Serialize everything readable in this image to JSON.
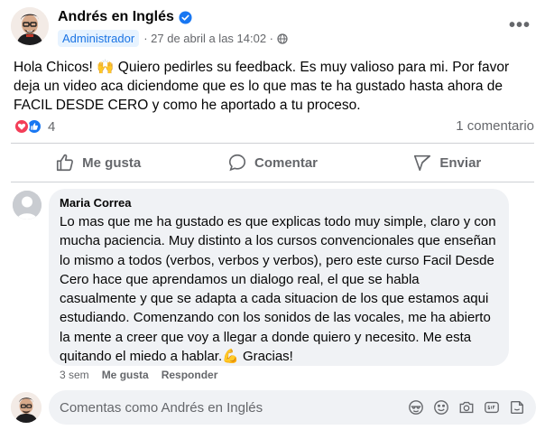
{
  "post": {
    "author": "Andrés en Inglés",
    "role_badge": "Administrador",
    "timestamp": "· 27 de abril a las 14:02 ·",
    "body": "Hola Chicos! 🙌 Quiero pedirles su feedback. Es muy valioso para mi. Por favor deja un video aca diciendome que es lo que mas te ha gustado hasta ahora de FACIL DESDE CERO y como he aportado a tu proceso.",
    "reaction_count": "4",
    "comment_count": "1 comentario",
    "more_label": "•••"
  },
  "actions": {
    "like": "Me gusta",
    "comment": "Comentar",
    "share": "Enviar"
  },
  "comment": {
    "author": "Maria Correa",
    "text": "Lo mas que me ha gustado es que explicas todo muy simple, claro y con mucha paciencia. Muy distinto a los cursos convencionales que enseñan lo mismo a todos (verbos, verbos y verbos), pero este curso Facil Desde Cero hace que aprendamos un dialogo real, el que se habla casualmente y que se adapta a cada situacion de los que estamos aqui estudiando. Comenzando con los sonidos de las vocales, me ha abierto la mente a creer que voy a llegar a donde quiero y necesito. Me esta quitando el miedo a hablar.💪 Gracias!",
    "age": "3 sem",
    "like_label": "Me gusta",
    "reply_label": "Responder"
  },
  "composer": {
    "placeholder": "Comentas como Andrés en Inglés"
  },
  "colors": {
    "accent": "#1877f2",
    "love": "#f33e58",
    "muted": "#65676b",
    "bubble": "#f0f2f5"
  },
  "icons": [
    "verified-badge-icon",
    "globe-icon",
    "more-icon",
    "love-reaction-icon",
    "like-reaction-icon",
    "thumbs-up-icon",
    "comment-icon",
    "share-icon",
    "avatar-icon",
    "sticker-icon",
    "emoji-icon",
    "camera-icon",
    "gif-icon",
    "draw-sticker-icon"
  ]
}
